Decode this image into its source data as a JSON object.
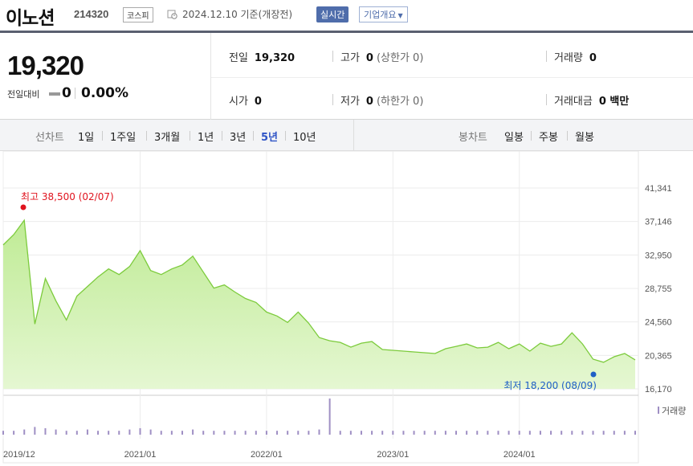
{
  "header": {
    "name": "이노션",
    "code": "214320",
    "market": "코스피",
    "base_date": "2024.12.10 기준(개장전)",
    "live_label": "실시간",
    "company_label": "기업개요"
  },
  "price": {
    "current": "19,320",
    "change_label": "전일대비",
    "change_value": "0",
    "change_pct": "0.00%"
  },
  "stats": {
    "prev": {
      "label": "전일",
      "value": "19,320"
    },
    "high": {
      "label": "고가",
      "value": "0",
      "sub": "(상한가 0)"
    },
    "volume": {
      "label": "거래량",
      "value": "0"
    },
    "open": {
      "label": "시가",
      "value": "0"
    },
    "low": {
      "label": "저가",
      "value": "0",
      "sub": "(하한가 0)"
    },
    "amount": {
      "label": "거래대금",
      "value": "0 백만"
    }
  },
  "tabs": {
    "line_label": "선차트",
    "line": [
      "1일",
      "1주일",
      "3개월",
      "1년",
      "3년",
      "5년",
      "10년"
    ],
    "active": "5년",
    "candle_label": "봉차트",
    "candle": [
      "일봉",
      "주봉",
      "월봉"
    ]
  },
  "chart_data": {
    "type": "area",
    "y_ticks": [
      "41,341",
      "37,146",
      "32,950",
      "28,755",
      "24,560",
      "20,365",
      "16,170"
    ],
    "ylim": [
      16170,
      41341
    ],
    "x_ticks": [
      "2019/12",
      "2021/01",
      "2022/01",
      "2023/01",
      "2024/01"
    ],
    "high_label": "최고 38,500 (02/07)",
    "low_label": "최저 18,200 (08/09)",
    "volume_label": "거래량",
    "colors": {
      "line": "#7ccb3c",
      "fill": "#e5f7d2",
      "high": "#e0131e",
      "low": "#1f5fc6",
      "volume": "#9f8fc4"
    },
    "x": [
      "2019/12",
      "2020/01",
      "2020/02",
      "2020/03",
      "2020/04",
      "2020/05",
      "2020/06",
      "2020/07",
      "2020/08",
      "2020/09",
      "2020/10",
      "2020/11",
      "2020/12",
      "2021/01",
      "2021/02",
      "2021/03",
      "2021/04",
      "2021/05",
      "2021/06",
      "2021/07",
      "2021/08",
      "2021/09",
      "2021/10",
      "2021/11",
      "2021/12",
      "2022/01",
      "2022/02",
      "2022/03",
      "2022/04",
      "2022/05",
      "2022/06",
      "2022/07",
      "2022/08",
      "2022/09",
      "2022/10",
      "2022/11",
      "2022/12",
      "2023/01",
      "2023/02",
      "2023/03",
      "2023/04",
      "2023/05",
      "2023/06",
      "2023/07",
      "2023/08",
      "2023/09",
      "2023/10",
      "2023/11",
      "2023/12",
      "2024/01",
      "2024/02",
      "2024/03",
      "2024/04",
      "2024/05",
      "2024/06",
      "2024/07",
      "2024/08",
      "2024/09",
      "2024/10",
      "2024/11",
      "2024/12"
    ],
    "values": [
      34200,
      35500,
      37300,
      24300,
      30000,
      27200,
      24800,
      27800,
      29000,
      30200,
      31200,
      30500,
      31500,
      33500,
      31000,
      30500,
      31200,
      31700,
      32800,
      30800,
      28800,
      29200,
      28300,
      27500,
      27000,
      25800,
      25300,
      24500,
      25800,
      24400,
      22600,
      22200,
      22000,
      21400,
      21900,
      22100,
      21100,
      21000,
      20900,
      20800,
      20700,
      20600,
      21200,
      21500,
      21800,
      21300,
      21400,
      22000,
      21200,
      21800,
      20900,
      21900,
      21500,
      21800,
      23200,
      21800,
      19900,
      19500,
      20200,
      20600,
      19800
    ],
    "volume_values": [
      3,
      3,
      4,
      6,
      5,
      4,
      3,
      3,
      4,
      3,
      3,
      3,
      4,
      5,
      4,
      3,
      3,
      3,
      4,
      3,
      3,
      3,
      3,
      3,
      3,
      3,
      3,
      3,
      3,
      3,
      4,
      28,
      3,
      3,
      3,
      3,
      3,
      3,
      3,
      3,
      3,
      3,
      3,
      3,
      3,
      3,
      3,
      3,
      3,
      3,
      3,
      3,
      3,
      3,
      3,
      3,
      3,
      3,
      3,
      3,
      3
    ]
  }
}
